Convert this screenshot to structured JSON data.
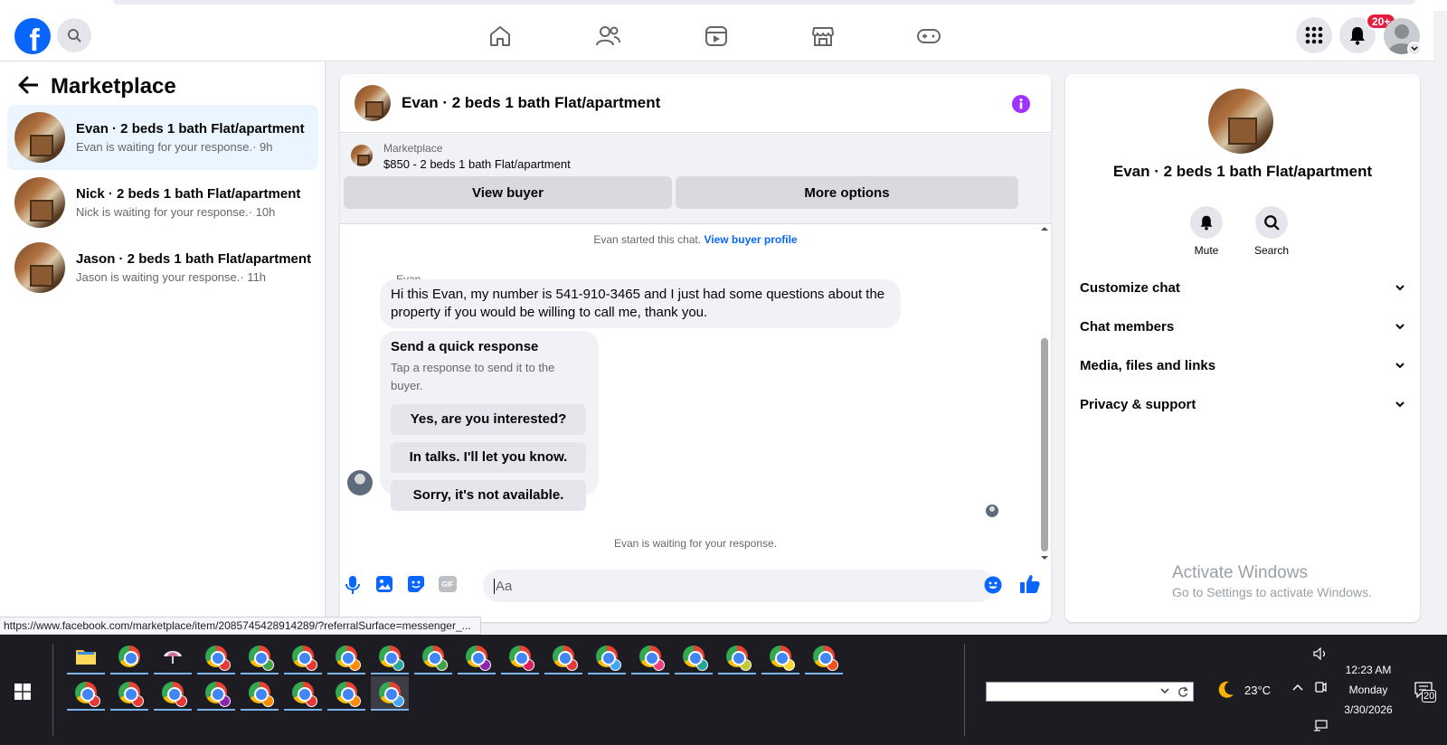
{
  "topbar": {
    "logo": "f",
    "notifications_badge": "20+",
    "icons": [
      "search-icon",
      "home-icon",
      "friends-icon",
      "video-icon",
      "marketplace-icon",
      "gaming-icon",
      "menu-grid-icon",
      "bell-icon",
      "avatar"
    ]
  },
  "left": {
    "title": "Marketplace",
    "conversations": [
      {
        "title": "Evan · 2 beds 1 bath Flat/apartment",
        "subtitle": "Evan is waiting for your response.",
        "time": "· 9h"
      },
      {
        "title": "Nick · 2 beds 1 bath Flat/apartment",
        "subtitle": "Nick is waiting for your response.",
        "time": "· 10h"
      },
      {
        "title": "Jason · 2 beds 1 bath Flat/apartment",
        "subtitle": "Jason is waiting your response.",
        "time": "· 11h"
      }
    ]
  },
  "chat": {
    "title": "Evan · 2 beds 1 bath Flat/apartment",
    "listing_label": "Marketplace",
    "listing_price": "$850 - 2 beds 1 bath Flat/apartment",
    "view_buyer": "View buyer",
    "more_options": "More options",
    "started_text": "Evan started this chat.",
    "view_profile": "View buyer profile",
    "sender": "Evan",
    "message": "Hi this Evan, my number is 541-910-3465 and I just had some questions about the property if you would be willing to call me, thank you.",
    "quick_title": "Send a quick response",
    "quick_sub": "Tap a response to send it to the buyer.",
    "quick_replies": [
      "Yes, are you interested?",
      "In talks. I'll let you know.",
      "Sorry, it's not available."
    ],
    "waiting": "Evan is waiting for your response.",
    "input_placeholder": "Aa"
  },
  "right": {
    "title": "Evan · 2 beds 1 bath Flat/apartment",
    "mute": "Mute",
    "search": "Search",
    "sections": [
      "Customize chat",
      "Chat members",
      "Media, files and links",
      "Privacy & support"
    ]
  },
  "watermark": {
    "line1": "Activate Windows",
    "line2": "Go to Settings to activate Windows."
  },
  "status_url": "https://www.facebook.com/marketplace/item/2085745428914289/?referralSurface=messenger_...",
  "taskbar": {
    "weather": "23°C",
    "time": "12:23 AM",
    "day": "Monday",
    "date": "3/30/2026",
    "notif_count": "20",
    "profile_colors_row1": [
      "#e53935",
      "#43a047",
      "#e53935",
      "#fb8c00",
      "#26a69a",
      "#43a047",
      "#8e24aa",
      "#d81b60",
      "#e53935",
      "#42a5f5",
      "#ec407a",
      "#26a69a",
      "#c0ca33",
      "#fdd835",
      "#f4511e"
    ],
    "profile_colors_row2": [
      "#e53935",
      "#e53935",
      "#e53935",
      "#8e24aa",
      "#fb8c00",
      "#e53935",
      "#fb8c00",
      "#42a5f5"
    ]
  }
}
